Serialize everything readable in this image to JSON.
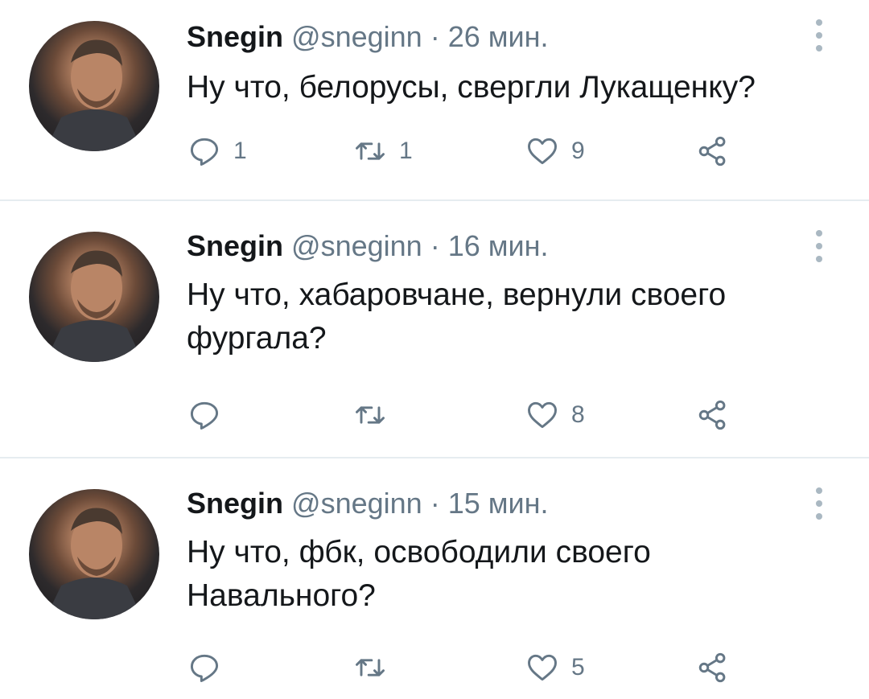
{
  "colors": {
    "text": "#14171a",
    "meta": "#657786",
    "icon": "#657786",
    "divider": "#e6ecf0"
  },
  "tweets": [
    {
      "name": "Snegin",
      "handle": "@sneginn",
      "separator": "·",
      "time": "26 мин.",
      "text": "Ну что, белорусы, свергли Лукащенку?",
      "replies": "1",
      "retweets": "1",
      "likes": "9"
    },
    {
      "name": "Snegin",
      "handle": "@sneginn",
      "separator": "·",
      "time": "16 мин.",
      "text": "Ну что, хабаровчане, вернули своего фургала?",
      "replies": "",
      "retweets": "",
      "likes": "8"
    },
    {
      "name": "Snegin",
      "handle": "@sneginn",
      "separator": "·",
      "time": "15 мин.",
      "text": "Ну что, фбк, освободили своего Навального?",
      "replies": "",
      "retweets": "",
      "likes": "5"
    }
  ],
  "icons": {
    "reply": "reply-icon",
    "retweet": "retweet-icon",
    "like": "heart-icon",
    "share": "share-icon",
    "more": "more-vertical-icon"
  }
}
